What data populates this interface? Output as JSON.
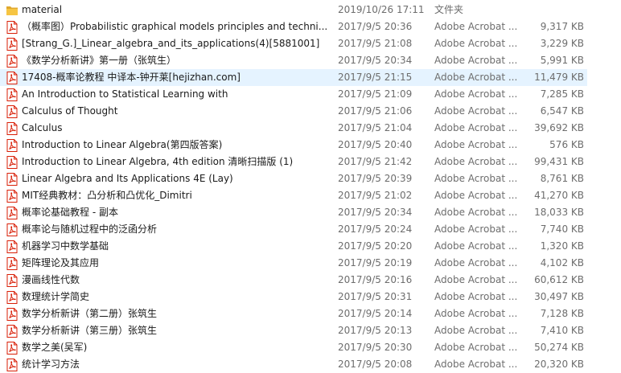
{
  "colors": {
    "selected_row": "#e5f3ff",
    "pdf_icon_red": "#d81e06",
    "folder_yellow": "#f6c543",
    "detail_text": "#6d6d6d"
  },
  "files": [
    {
      "icon": "folder-icon",
      "name": "material",
      "date": "2019/10/26 17:11",
      "type": "文件夹",
      "size": ""
    },
    {
      "icon": "pdf-icon",
      "name": "（概率图）Probabilistic graphical models  principles and techni...",
      "date": "2017/9/5 20:36",
      "type": "Adobe Acrobat ...",
      "size": "9,317 KB"
    },
    {
      "icon": "pdf-icon",
      "name": "[Strang_G.]_Linear_algebra_and_its_applications(4)[5881001]",
      "date": "2017/9/5 21:08",
      "type": "Adobe Acrobat ...",
      "size": "3,229 KB"
    },
    {
      "icon": "pdf-icon",
      "name": "《数学分析新讲》第一册（张筑生）",
      "date": "2017/9/5 20:34",
      "type": "Adobe Acrobat ...",
      "size": "5,991 KB"
    },
    {
      "icon": "pdf-icon",
      "name": "17408-概率论教程 中译本-钟开莱[hejizhan.com]",
      "date": "2017/9/5 21:15",
      "type": "Adobe Acrobat ...",
      "size": "11,479 KB",
      "selected": true
    },
    {
      "icon": "pdf-icon",
      "name": "An Introduction to Statistical Learning with",
      "date": "2017/9/5 21:09",
      "type": "Adobe Acrobat ...",
      "size": "7,285 KB"
    },
    {
      "icon": "pdf-icon",
      "name": "Calculus of Thought",
      "date": "2017/9/5 21:06",
      "type": "Adobe Acrobat ...",
      "size": "6,547 KB"
    },
    {
      "icon": "pdf-icon",
      "name": "Calculus",
      "date": "2017/9/5 21:04",
      "type": "Adobe Acrobat ...",
      "size": "39,692 KB"
    },
    {
      "icon": "pdf-icon",
      "name": "Introduction to Linear Algebra(第四版答案)",
      "date": "2017/9/5 20:40",
      "type": "Adobe Acrobat ...",
      "size": "576 KB"
    },
    {
      "icon": "pdf-icon",
      "name": "Introduction to Linear Algebra, 4th edition 清晰扫描版 (1)",
      "date": "2017/9/5 21:42",
      "type": "Adobe Acrobat ...",
      "size": "99,431 KB"
    },
    {
      "icon": "pdf-icon",
      "name": "Linear Algebra and Its Applications 4E (Lay)",
      "date": "2017/9/5 20:39",
      "type": "Adobe Acrobat ...",
      "size": "8,761 KB"
    },
    {
      "icon": "pdf-icon",
      "name": "MIT经典教材：凸分析和凸优化_Dimitri",
      "date": "2017/9/5 21:02",
      "type": "Adobe Acrobat ...",
      "size": "41,270 KB"
    },
    {
      "icon": "pdf-icon",
      "name": "概率论基础教程 - 副本",
      "date": "2017/9/5 20:34",
      "type": "Adobe Acrobat ...",
      "size": "18,033 KB"
    },
    {
      "icon": "pdf-icon",
      "name": "概率论与随机过程中的泛函分析",
      "date": "2017/9/5 20:24",
      "type": "Adobe Acrobat ...",
      "size": "7,740 KB"
    },
    {
      "icon": "pdf-icon",
      "name": "机器学习中数学基础",
      "date": "2017/9/5 20:20",
      "type": "Adobe Acrobat ...",
      "size": "1,320 KB"
    },
    {
      "icon": "pdf-icon",
      "name": "矩阵理论及其应用",
      "date": "2017/9/5 20:19",
      "type": "Adobe Acrobat ...",
      "size": "4,102 KB"
    },
    {
      "icon": "pdf-icon",
      "name": "漫画线性代数",
      "date": "2017/9/5 20:16",
      "type": "Adobe Acrobat ...",
      "size": "60,612 KB"
    },
    {
      "icon": "pdf-icon",
      "name": "数理统计学简史",
      "date": "2017/9/5 20:31",
      "type": "Adobe Acrobat ...",
      "size": "30,497 KB"
    },
    {
      "icon": "pdf-icon",
      "name": "数学分析新讲（第二册）张筑生",
      "date": "2017/9/5 20:14",
      "type": "Adobe Acrobat ...",
      "size": "7,128 KB"
    },
    {
      "icon": "pdf-icon",
      "name": "数学分析新讲（第三册）张筑生",
      "date": "2017/9/5 20:13",
      "type": "Adobe Acrobat ...",
      "size": "7,410 KB"
    },
    {
      "icon": "pdf-icon",
      "name": "数学之美(吴军)",
      "date": "2017/9/5 20:30",
      "type": "Adobe Acrobat ...",
      "size": "50,274 KB"
    },
    {
      "icon": "pdf-icon",
      "name": "统计学习方法",
      "date": "2017/9/5 20:08",
      "type": "Adobe Acrobat ...",
      "size": "20,320 KB"
    }
  ]
}
